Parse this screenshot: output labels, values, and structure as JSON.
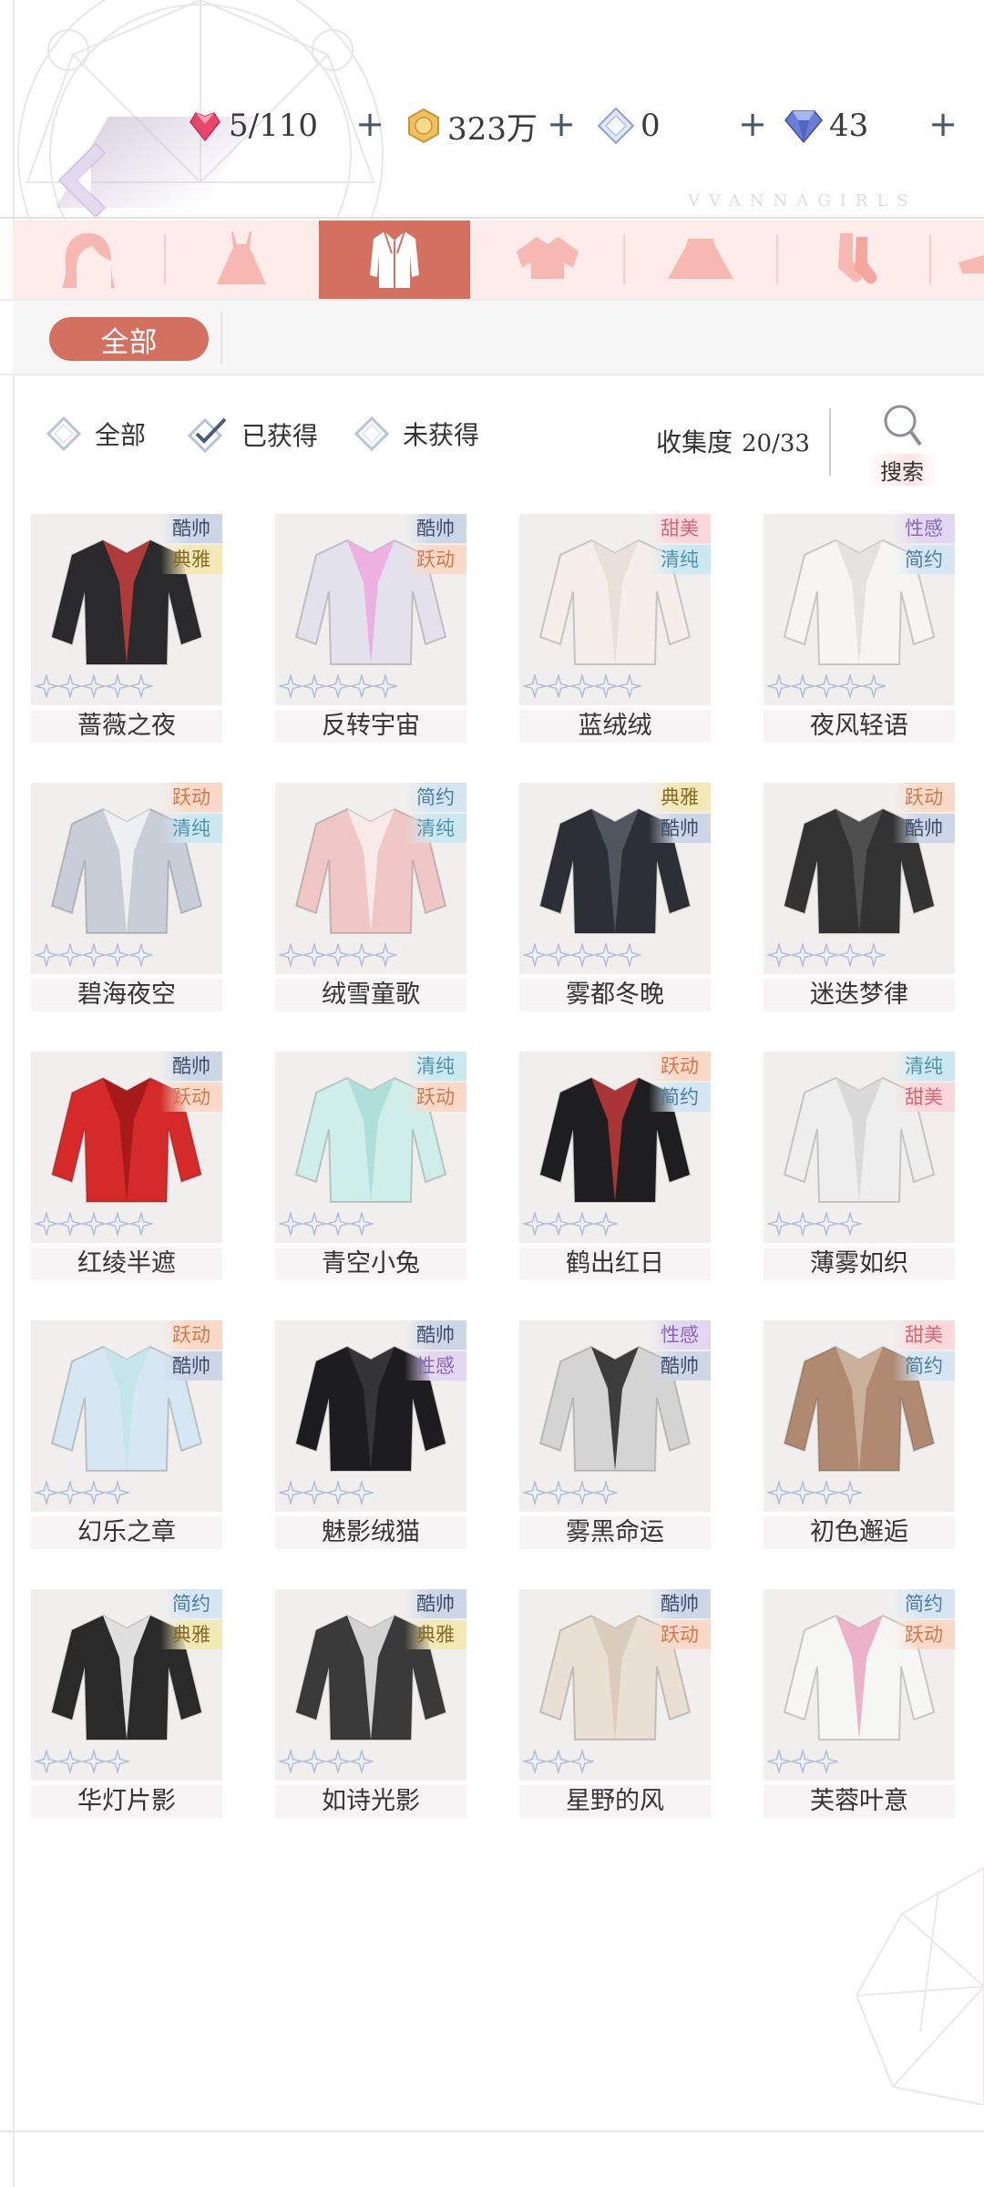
{
  "header": {
    "brand": "VVANNAGIRLS",
    "resources": [
      {
        "icon": "heart-gem-icon",
        "value": "5/110"
      },
      {
        "icon": "gold-coin-icon",
        "value": "323万"
      },
      {
        "icon": "crystal-diamond-icon",
        "value": "0"
      },
      {
        "icon": "blue-diamond-icon",
        "value": "43"
      }
    ]
  },
  "categories": [
    {
      "icon": "hair-icon",
      "selected": false
    },
    {
      "icon": "dress-icon",
      "selected": false
    },
    {
      "icon": "coat-icon",
      "selected": true
    },
    {
      "icon": "top-icon",
      "selected": false
    },
    {
      "icon": "skirt-icon",
      "selected": false
    },
    {
      "icon": "socks-icon",
      "selected": false
    },
    {
      "icon": "shoes-icon",
      "selected": false
    }
  ],
  "filter": {
    "all_label": "全部",
    "radios": [
      {
        "label": "全部",
        "checked": false
      },
      {
        "label": "已获得",
        "checked": true
      },
      {
        "label": "未获得",
        "checked": false
      }
    ],
    "collect_label": "收集度",
    "collect_value": "20/33",
    "search_label": "搜索"
  },
  "items": [
    {
      "name": "蔷薇之夜",
      "tags": [
        "酷帅",
        "典雅"
      ],
      "stars": 5,
      "colors": [
        "#2a2a2d",
        "#c73d3d"
      ]
    },
    {
      "name": "反转宇宙",
      "tags": [
        "酷帅",
        "跃动"
      ],
      "stars": 5,
      "colors": [
        "#e3e1ec",
        "#f0a6df"
      ]
    },
    {
      "name": "蓝绒绒",
      "tags": [
        "甜美",
        "清纯"
      ],
      "stars": 5,
      "colors": [
        "#f5eeea",
        "#e6ddd7"
      ]
    },
    {
      "name": "夜风轻语",
      "tags": [
        "性感",
        "简约"
      ],
      "stars": 5,
      "colors": [
        "#f7f5f3",
        "#e2dfdc"
      ]
    },
    {
      "name": "碧海夜空",
      "tags": [
        "跃动",
        "清纯"
      ],
      "stars": 5,
      "colors": [
        "#c9cdd8",
        "#f4f4f6"
      ]
    },
    {
      "name": "绒雪童歌",
      "tags": [
        "简约",
        "清纯"
      ],
      "stars": 5,
      "colors": [
        "#f0c7c6",
        "#fbeeee"
      ]
    },
    {
      "name": "雾都冬晚",
      "tags": [
        "典雅",
        "酷帅"
      ],
      "stars": 5,
      "colors": [
        "#2c2f36",
        "#585c66"
      ]
    },
    {
      "name": "迷迭梦律",
      "tags": [
        "跃动",
        "酷帅"
      ],
      "stars": 5,
      "colors": [
        "#333333",
        "#555555"
      ]
    },
    {
      "name": "红绫半遮",
      "tags": [
        "酷帅",
        "跃动"
      ],
      "stars": 5,
      "colors": [
        "#d42a2a",
        "#9e1818"
      ]
    },
    {
      "name": "青空小兔",
      "tags": [
        "清纯",
        "跃动"
      ],
      "stars": 4,
      "colors": [
        "#cfeeea",
        "#a8ddd6"
      ]
    },
    {
      "name": "鹤出红日",
      "tags": [
        "跃动",
        "简约"
      ],
      "stars": 4,
      "colors": [
        "#1e1e20",
        "#c2383a"
      ]
    },
    {
      "name": "薄雾如织",
      "tags": [
        "清纯",
        "甜美"
      ],
      "stars": 4,
      "colors": [
        "#eeeeee",
        "#d6d6d6"
      ]
    },
    {
      "name": "幻乐之章",
      "tags": [
        "跃动",
        "酷帅"
      ],
      "stars": 4,
      "colors": [
        "#d6e6f2",
        "#bfe6e6"
      ]
    },
    {
      "name": "魅影绒猫",
      "tags": [
        "酷帅",
        "性感"
      ],
      "stars": 4,
      "colors": [
        "#1d1d1f",
        "#3a3a3c"
      ]
    },
    {
      "name": "雾黑命运",
      "tags": [
        "性感",
        "酷帅"
      ],
      "stars": 4,
      "colors": [
        "#d4d4d4",
        "#222222"
      ]
    },
    {
      "name": "初色邂逅",
      "tags": [
        "甜美",
        "简约"
      ],
      "stars": 4,
      "colors": [
        "#b08a70",
        "#cfb6a0"
      ]
    },
    {
      "name": "华灯片影",
      "tags": [
        "简约",
        "典雅"
      ],
      "stars": 4,
      "colors": [
        "#2a2a2a",
        "#ffffff"
      ]
    },
    {
      "name": "如诗光影",
      "tags": [
        "酷帅",
        "典雅"
      ],
      "stars": 4,
      "colors": [
        "#3a3a3a",
        "#efefef"
      ]
    },
    {
      "name": "星野的风",
      "tags": [
        "酷帅",
        "跃动"
      ],
      "stars": 3,
      "colors": [
        "#e9dfd2",
        "#d8cab8"
      ]
    },
    {
      "name": "芙蓉叶意",
      "tags": [
        "简约",
        "跃动"
      ],
      "stars": 3,
      "colors": [
        "#f6f6f4",
        "#e9a6c2"
      ]
    }
  ]
}
